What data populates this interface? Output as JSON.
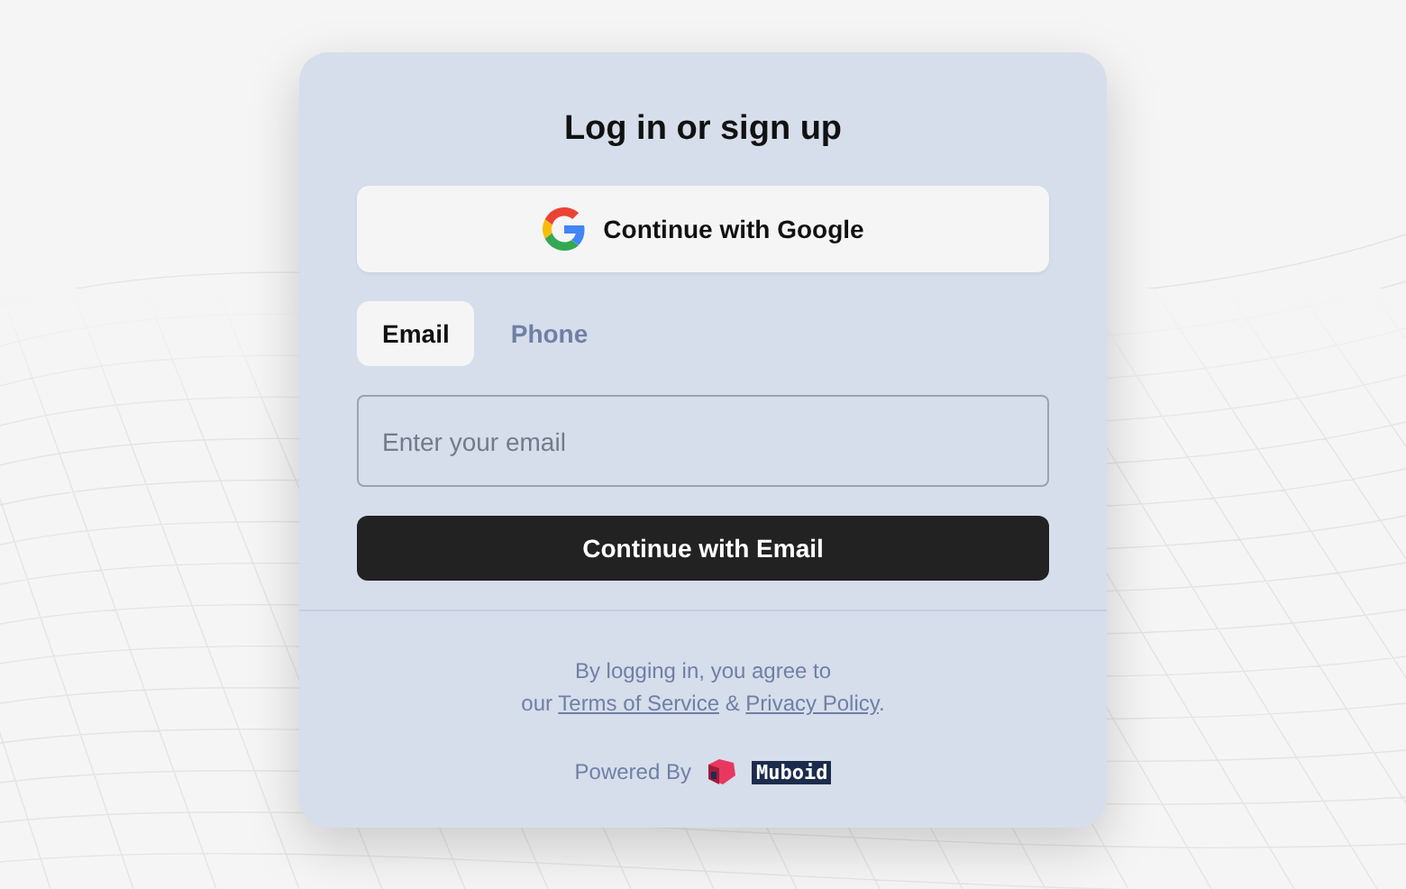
{
  "title": "Log in or sign up",
  "google_button": {
    "label": "Continue with Google"
  },
  "tabs": [
    {
      "label": "Email",
      "selected": true
    },
    {
      "label": "Phone",
      "selected": false
    }
  ],
  "email_field": {
    "placeholder": "Enter your email"
  },
  "submit_button": {
    "label": "Continue with Email"
  },
  "legal": {
    "line_1": "By logging in, you agree to",
    "prefix": "our",
    "terms_link": "Terms of Service",
    "joiner": "&",
    "privacy_link": "Privacy Policy",
    "suffix": "."
  },
  "powered_by": {
    "label": "Powered By",
    "brand": "Muboid"
  }
}
